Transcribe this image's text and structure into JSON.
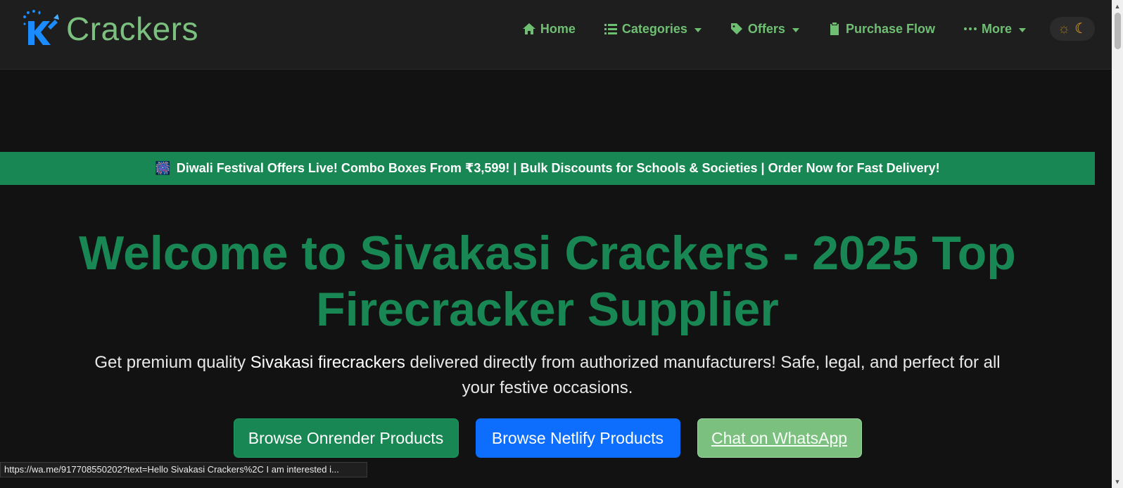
{
  "brand": {
    "name": "Crackers",
    "logo_icon": "k-sparkle-logo-icon"
  },
  "nav": {
    "items": [
      {
        "label": "Home",
        "icon": "home-icon",
        "dropdown": false
      },
      {
        "label": "Categories",
        "icon": "list-icon",
        "dropdown": true
      },
      {
        "label": "Offers",
        "icon": "tag-icon",
        "dropdown": true
      },
      {
        "label": "Purchase Flow",
        "icon": "clipboard-icon",
        "dropdown": false
      },
      {
        "label": "More",
        "icon": "ellipsis-icon",
        "dropdown": true
      }
    ],
    "theme_toggle": {
      "sun_icon": "sun-icon",
      "moon_icon": "moon-icon"
    }
  },
  "banner": {
    "icon": "🎆",
    "text": "Diwali Festival Offers Live! Combo Boxes From ₹3,599! | Bulk Discounts for Schools & Societies | Order Now for Fast Delivery!"
  },
  "hero": {
    "title": "Welcome to Sivakasi Crackers - 2025 Top Firecracker Supplier",
    "subtitle_pre": "Get premium quality ",
    "subtitle_strong": "Sivakasi firecrackers",
    "subtitle_post": " delivered directly from authorized manufacturers! Safe, legal, and perfect for all your festive occasions."
  },
  "buttons": {
    "onrender": "Browse Onrender Products",
    "netlify": "Browse Netlify Products",
    "whatsapp": "Chat on WhatsApp"
  },
  "status_bar": {
    "url": "https://wa.me/917708550202?text=Hello Sivakasi Crackers%2C I am interested i..."
  },
  "colors": {
    "primary_green": "#198754",
    "light_green": "#7cc07f",
    "blue": "#0d6efd",
    "background": "#121212",
    "navbar": "#1e1e1e"
  }
}
